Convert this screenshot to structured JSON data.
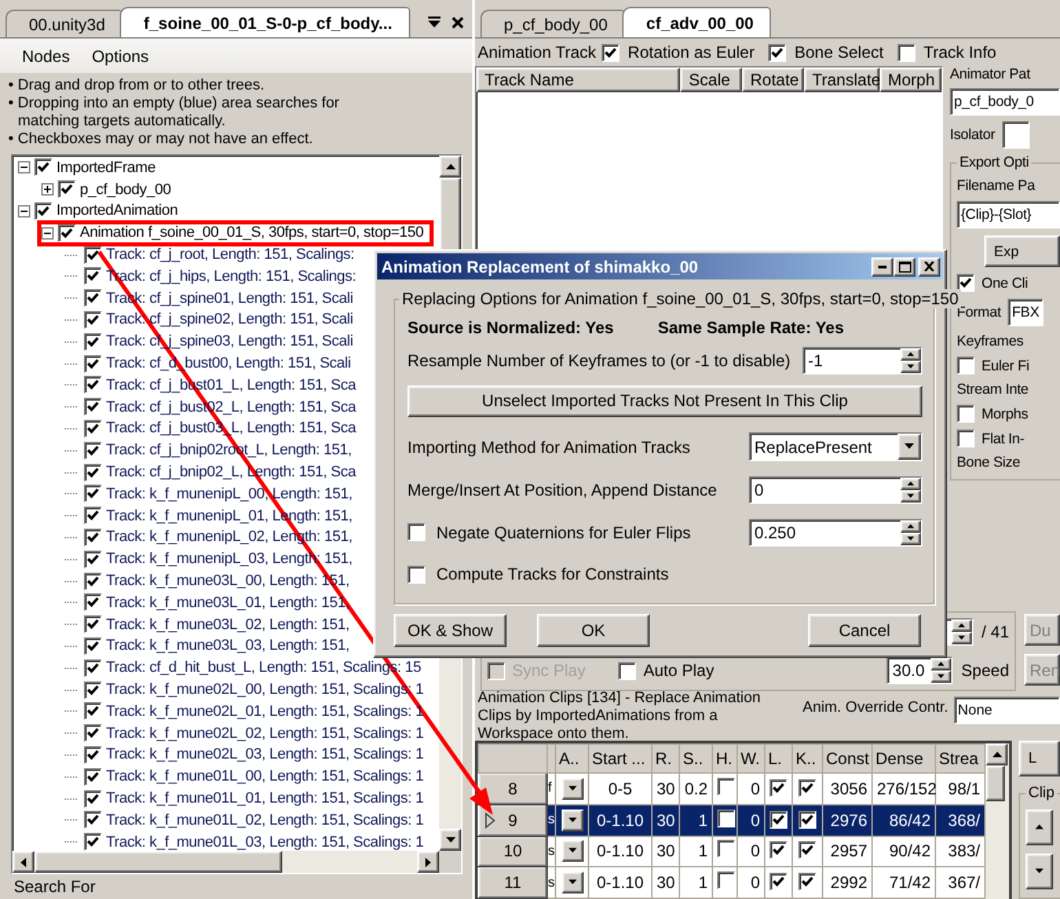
{
  "left_pane": {
    "tabs": [
      {
        "label": "00.unity3d",
        "selected": false
      },
      {
        "label": "f_soine_00_01_S-0-p_cf_body...",
        "selected": true
      }
    ],
    "menu": [
      "Nodes",
      "Options"
    ],
    "hints": [
      "• Drag and drop from or to other trees.",
      "• Dropping into an empty (blue) area searches for matching targets automatically.",
      "• Checkboxes may or may not have an effect."
    ],
    "tree": [
      {
        "label": "ImportedFrame",
        "checked": true,
        "expanded": true,
        "children": [
          {
            "label": "p_cf_body_00",
            "checked": true,
            "expanded": false
          }
        ]
      },
      {
        "label": "ImportedAnimation",
        "checked": true,
        "expanded": true,
        "children": [
          {
            "label": "Animation f_soine_00_01_S, 30fps, start=0, stop=150",
            "checked": true,
            "expanded": true,
            "highlighted": true,
            "children": [
              {
                "label": "Track: cf_j_root, Length: 151, Scalings:",
                "checked": true
              },
              {
                "label": "Track: cf_j_hips, Length: 151, Scalings:",
                "checked": true
              },
              {
                "label": "Track: cf_j_spine01, Length: 151, Scali",
                "checked": true
              },
              {
                "label": "Track: cf_j_spine02, Length: 151, Scali",
                "checked": true
              },
              {
                "label": "Track: cf_j_spine03, Length: 151, Scali",
                "checked": true
              },
              {
                "label": "Track: cf_d_bust00, Length: 151, Scali",
                "checked": true
              },
              {
                "label": "Track: cf_j_bust01_L, Length: 151, Sca",
                "checked": true
              },
              {
                "label": "Track: cf_j_bust02_L, Length: 151, Sca",
                "checked": true
              },
              {
                "label": "Track: cf_j_bust03_L, Length: 151, Sca",
                "checked": true
              },
              {
                "label": "Track: cf_j_bnip02root_L, Length: 151,",
                "checked": true
              },
              {
                "label": "Track: cf_j_bnip02_L, Length: 151, Sca",
                "checked": true
              },
              {
                "label": "Track: k_f_munenipL_00, Length: 151,",
                "checked": true
              },
              {
                "label": "Track: k_f_munenipL_01, Length: 151,",
                "checked": true
              },
              {
                "label": "Track: k_f_munenipL_02, Length: 151,",
                "checked": true
              },
              {
                "label": "Track: k_f_munenipL_03, Length: 151,",
                "checked": true
              },
              {
                "label": "Track: k_f_mune03L_00, Length: 151,",
                "checked": true
              },
              {
                "label": "Track: k_f_mune03L_01, Length: 151,",
                "checked": true
              },
              {
                "label": "Track: k_f_mune03L_02, Length: 151,",
                "checked": true
              },
              {
                "label": "Track: k_f_mune03L_03, Length: 151,",
                "checked": true
              },
              {
                "label": "Track: cf_d_hit_bust_L, Length: 151, Scalings: 15",
                "checked": true
              },
              {
                "label": "Track: k_f_mune02L_00, Length: 151, Scalings: 1",
                "checked": true
              },
              {
                "label": "Track: k_f_mune02L_01, Length: 151, Scalings: 1",
                "checked": true
              },
              {
                "label": "Track: k_f_mune02L_02, Length: 151, Scalings: 1",
                "checked": true
              },
              {
                "label": "Track: k_f_mune02L_03, Length: 151, Scalings: 1",
                "checked": true
              },
              {
                "label": "Track: k_f_mune01L_00, Length: 151, Scalings: 1",
                "checked": true
              },
              {
                "label": "Track: k_f_mune01L_01, Length: 151, Scalings: 1",
                "checked": true
              },
              {
                "label": "Track: k_f_mune01L_02, Length: 151, Scalings: 1",
                "checked": true
              },
              {
                "label": "Track: k_f_mune01L_03, Length: 151, Scalings: 1",
                "checked": true
              }
            ]
          }
        ]
      }
    ],
    "search_label": "Search For"
  },
  "right_pane": {
    "tabs": [
      {
        "label": "p_cf_body_00",
        "selected": false
      },
      {
        "label": "cf_adv_00_00",
        "selected": true
      }
    ],
    "track_options": {
      "label": "Animation Track",
      "checkboxes": [
        {
          "label": "Rotation as Euler",
          "checked": true
        },
        {
          "label": "Bone Select",
          "checked": true
        },
        {
          "label": "Track Info",
          "checked": false
        }
      ]
    },
    "track_table": {
      "columns": [
        "Track Name",
        "Scale",
        "Rotate",
        "Translate",
        "Morph"
      ]
    },
    "animator_panel": {
      "path_label": "Animator Pat",
      "path_value": "p_cf_body_0",
      "isolator_label": "Isolator",
      "export_group": "Export Opti",
      "filename_label": "Filename Pa",
      "filename_value": "{Clip}-{Slot}",
      "export_button": "Exp",
      "one_clip": {
        "label": "One Cli",
        "checked": true
      },
      "format_label": "Format",
      "format_value": "FBX",
      "keyframes_label": "Keyframes",
      "euler": {
        "label": "Euler Fi",
        "checked": false
      },
      "stream_label": "Stream Inte",
      "morphs": {
        "label": "Morphs",
        "checked": false
      },
      "flat": {
        "label": "Flat In-",
        "checked": false
      },
      "bone_size_label": "Bone Size"
    },
    "playback": {
      "frame_total": "/ 41",
      "sync_play": {
        "label": "Sync Play",
        "checked": false,
        "disabled": true
      },
      "auto_play": {
        "label": "Auto Play",
        "checked": false,
        "disabled": false
      },
      "speed_value": "30.0",
      "speed_label": "Speed",
      "buttons": [
        "Du",
        "Ren"
      ]
    },
    "clips": {
      "title": "Animation Clips [134] - Replace Animation Clips by ImportedAnimations from a Workspace onto them.",
      "override_label": "Anim. Override Contr.",
      "override_value": "None",
      "columns": [
        "A..",
        "Start ...",
        "R.",
        "S..",
        "H.",
        "W.",
        "L.",
        "K..",
        "Const",
        "Dense",
        "Strea"
      ],
      "rows": [
        {
          "index": "8",
          "name": "f",
          "start": "0-5",
          "r": "30",
          "s": "0.2",
          "h": false,
          "w": "0",
          "l": true,
          "k": true,
          "const": "3056",
          "dense": "276/152",
          "stream": "98/1",
          "selected": false
        },
        {
          "index": "9",
          "name": "s",
          "start": "0-1.10",
          "r": "30",
          "s": "1",
          "h": false,
          "w": "0",
          "l": true,
          "k": true,
          "const": "2976",
          "dense": "86/42",
          "stream": "368/",
          "selected": true
        },
        {
          "index": "10",
          "name": "s",
          "start": "0-1.10",
          "r": "30",
          "s": "1",
          "h": false,
          "w": "0",
          "l": true,
          "k": true,
          "const": "2957",
          "dense": "90/42",
          "stream": "383/",
          "selected": false
        },
        {
          "index": "11",
          "name": "s",
          "start": "0-1.10",
          "r": "30",
          "s": "1",
          "h": false,
          "w": "0",
          "l": true,
          "k": true,
          "const": "2992",
          "dense": "71/42",
          "stream": "367/",
          "selected": false
        }
      ],
      "side_button": "L",
      "group_label": "Clip"
    }
  },
  "dialog": {
    "title": "Animation Replacement of shimakko_00",
    "group_label": "Replacing Options for Animation f_soine_00_01_S, 30fps, start=0, stop=150",
    "source_normalized": "Source is Normalized: Yes",
    "same_rate": "Same Sample Rate: Yes",
    "resample": {
      "label": "Resample Number of Keyframes to (or -1 to disable)",
      "value": "-1"
    },
    "unselect_button": "Unselect Imported Tracks Not Present In This Clip",
    "method": {
      "label": "Importing Method for Animation Tracks",
      "value": "ReplacePresent"
    },
    "merge": {
      "label": "Merge/Insert At Position, Append Distance",
      "value": "0"
    },
    "negate": {
      "label": "Negate Quaternions for Euler Flips",
      "checked": false,
      "value": "0.250"
    },
    "compute": {
      "label": "Compute Tracks for Constraints",
      "checked": false
    },
    "buttons": [
      "OK & Show",
      "OK",
      "Cancel"
    ]
  }
}
